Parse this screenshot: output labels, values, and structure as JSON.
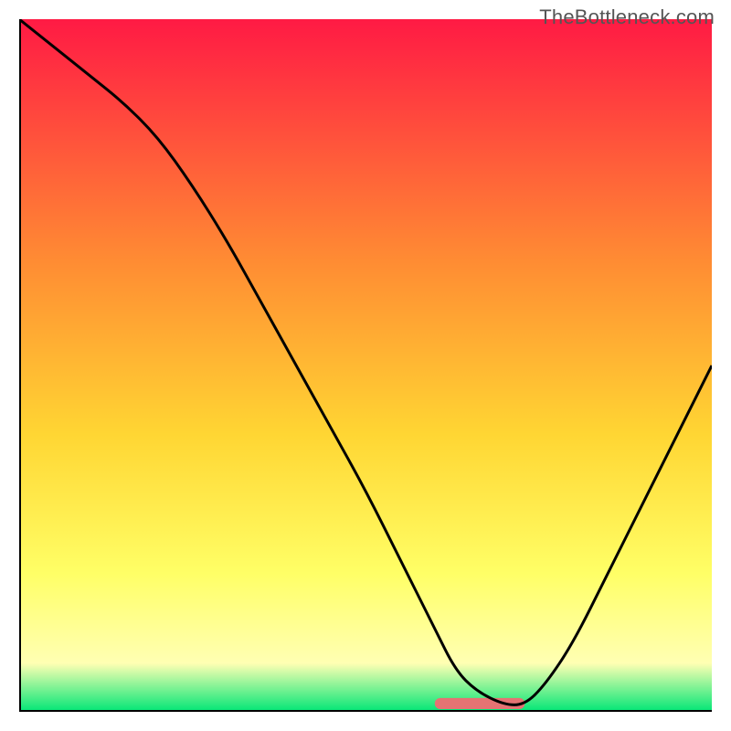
{
  "watermark": "TheBottleneck.com",
  "chart_data": {
    "type": "line",
    "title": "",
    "xlabel": "",
    "ylabel": "",
    "xlim": [
      0,
      100
    ],
    "ylim": [
      0,
      100
    ],
    "legend": false,
    "grid": false,
    "background_gradient": {
      "stops": [
        {
          "pos": 0,
          "color": "#ff1a44"
        },
        {
          "pos": 35,
          "color": "#ff8c33"
        },
        {
          "pos": 60,
          "color": "#ffd633"
        },
        {
          "pos": 80,
          "color": "#ffff66"
        },
        {
          "pos": 93,
          "color": "#ffffb3"
        },
        {
          "pos": 100,
          "color": "#00e676"
        }
      ]
    },
    "band_at_bottom": {
      "x_start": 60,
      "x_end": 73,
      "y": 1.2,
      "color": "#e57373",
      "height_pct": 1.6
    },
    "series": [
      {
        "name": "curve",
        "color": "#000000",
        "x": [
          0,
          5,
          10,
          15,
          20,
          25,
          30,
          35,
          40,
          45,
          50,
          55,
          60,
          63,
          66,
          70,
          73,
          76,
          80,
          85,
          90,
          95,
          100
        ],
        "y": [
          100,
          96,
          92,
          88,
          83,
          76,
          68,
          59,
          50,
          41,
          32,
          22,
          12,
          6,
          3,
          1,
          1,
          4,
          10,
          20,
          30,
          40,
          50
        ]
      }
    ]
  }
}
